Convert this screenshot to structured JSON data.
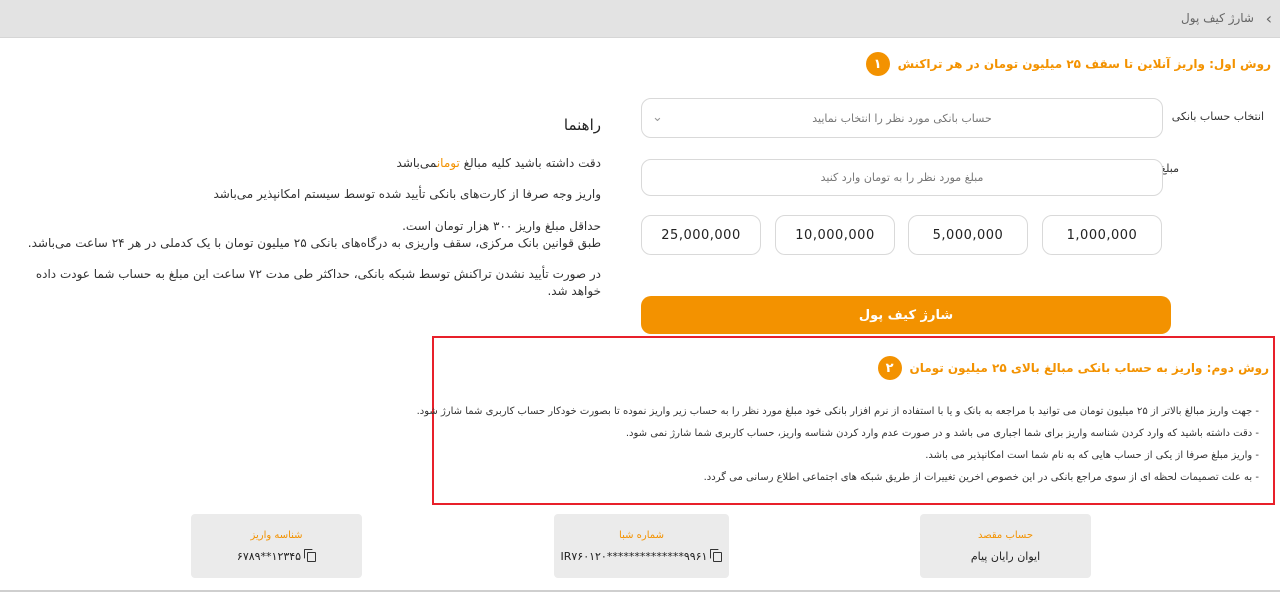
{
  "header": {
    "back_icon": "chevron-right-icon",
    "title": "شارژ کیف پول"
  },
  "method1": {
    "number": "۱",
    "title": "روش اول: واریز آنلاین تا سقف ۲۵ میلیون تومان در هر تراکنش",
    "bank_label": "انتخاب حساب بانکی",
    "bank_placeholder": "حساب بانکی مورد نظر را انتخاب نمایید",
    "amount_label": "مبلغ",
    "amount_placeholder": "مبلغ مورد نظر را به تومان وارد کنید",
    "quick_amounts": [
      "1,000,000",
      "5,000,000",
      "10,000,000",
      "25,000,000"
    ],
    "charge_button": "شارژ کیف پول"
  },
  "guide": {
    "title": "راهنما",
    "p1_before": "دقت داشته باشید کلیه مبالغ",
    "p1_highlight": "تومان",
    "p1_after": "می‌باشد",
    "p2": "واریز وجه صرفا از کارت‌های بانکی تأیید شده توسط سیستم امکانپذیر می‌باشد",
    "p3_line1": "حداقل مبلغ واریز ۳۰۰ هزار تومان است.",
    "p3_line2": "طبق قوانین بانک مرکزی، سقف واریزی به درگاه‌های بانکی ۲۵ میلیون تومان با یک کدملی در هر ۲۴ ساعت می‌باشد.",
    "p4_line1": "در صورت تأیید نشدن تراکنش توسط شبکه بانکی، حداکثر طی مدت ۷۲ ساعت این مبلغ به حساب شما عودت داده",
    "p4_line2": "خواهد شد."
  },
  "method2": {
    "number": "۲",
    "title": "روش دوم: واریز به حساب بانکی مبالغ بالای ۲۵ میلیون تومان",
    "bullets": [
      "- جهت واریز مبالغ بالاتر از ۲۵ میلیون تومان می توانید با مراجعه به بانک و یا با استفاده از نرم افزار بانکی خود مبلغ مورد نظر را به حساب زیر واریز نموده تا بصورت خودکار حساب کاربری شما شارژ شود.",
      "- دقت داشته باشید که وارد کردن شناسه واریز برای شما اجباری می باشد و در صورت عدم وارد کردن شناسه واریز، حساب کاربری شما شارژ نمی شود.",
      "- واریز مبلغ صرفا از یکی از حساب هایی که به نام شما است امکانپذیر می باشد.",
      "- به علت تصمیمات لحظه ای از سوی مراجع بانکی در این خصوص اخرین تغییرات از طریق شبکه های اجتماعی اطلاع رسانی می گردد."
    ]
  },
  "cards": {
    "destination_title": "حساب مقصد",
    "destination_value": "ایوان رایان پیام",
    "sheba_title": "شماره شبا",
    "sheba_value": "IR۷۶۰۱۲۰**************۹۹۶۱",
    "deposit_id_title": "شناسه واریز",
    "deposit_id_value": "۶۷۸۹**۱۲۳۴۵"
  },
  "colors": {
    "accent": "#f39200",
    "highlight_border": "#e8202a"
  }
}
